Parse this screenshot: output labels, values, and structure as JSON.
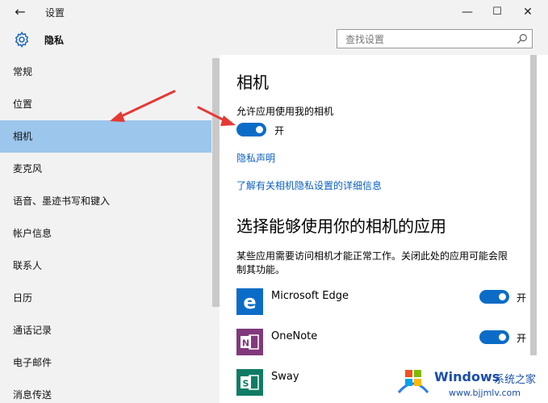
{
  "window": {
    "title": "设置",
    "back_icon": "back-arrow-icon",
    "minimize": "—",
    "maximize": "☐",
    "close": "✕"
  },
  "header": {
    "title": "隐私",
    "icon": "gear-icon",
    "search_placeholder": "查找设置"
  },
  "sidebar": {
    "items": [
      {
        "label": "常规"
      },
      {
        "label": "位置"
      },
      {
        "label": "相机",
        "selected": true
      },
      {
        "label": "麦克风"
      },
      {
        "label": "语音、墨迹书写和键入"
      },
      {
        "label": "帐户信息"
      },
      {
        "label": "联系人"
      },
      {
        "label": "日历"
      },
      {
        "label": "通话记录"
      },
      {
        "label": "电子邮件"
      },
      {
        "label": "消息传送"
      }
    ]
  },
  "content": {
    "title": "相机",
    "allow_label": "允许应用使用我的相机",
    "toggle_state": "开",
    "privacy_link": "隐私声明",
    "learn_more_link": "了解有关相机隐私设置的详细信息",
    "apps_title": "选择能够使用你的相机的应用",
    "apps_desc_line1": "某些应用需要访问相机才能正常工作。关闭此处的应用可能会限",
    "apps_desc_line2": "制其功能。",
    "apps": [
      {
        "name": "Microsoft Edge",
        "state": "开",
        "icon": "edge-icon",
        "color": "#0b6cc7"
      },
      {
        "name": "OneNote",
        "state": "开",
        "icon": "onenote-icon",
        "color": "#80397b"
      },
      {
        "name": "Sway",
        "state": "",
        "icon": "sway-icon",
        "color": "#107c65"
      }
    ]
  },
  "watermark": {
    "title": "Windows",
    "cn": "系统之家",
    "url": "www.bjjmlv.com"
  },
  "colors": {
    "accent": "#0b6cc7",
    "selected_bg": "#9cc6ec",
    "arrow": "#e53935"
  }
}
